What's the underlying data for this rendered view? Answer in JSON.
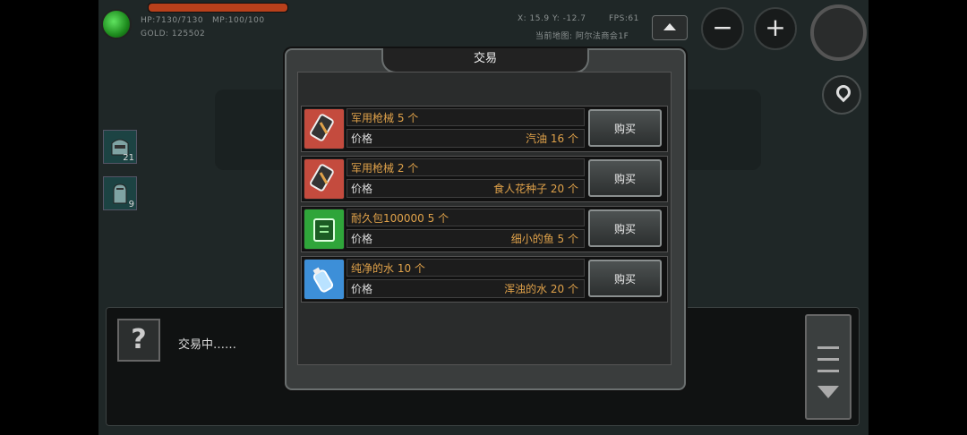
{
  "hud": {
    "hp": "HP:7130/7130",
    "mp": "MP:100/100",
    "gold": "GOLD: 125502",
    "coords": "X: 15.9 Y: -12.7",
    "fps": "FPS:61",
    "location": "当前地图: 阿尔法商会1F",
    "hp_fraction": 1.0,
    "zoom_out": "−",
    "zoom_in": "+"
  },
  "quickslots": [
    {
      "icon": "helmet-icon",
      "count": "21"
    },
    {
      "icon": "gauntlet-icon",
      "count": "9"
    }
  ],
  "dialog": {
    "text": "交易中……",
    "portrait": "?"
  },
  "trade": {
    "title": "交易",
    "price_label": "价格",
    "buy_label": "购买",
    "items": [
      {
        "name": "军用枪械 5 个",
        "price": "汽油 16 个",
        "icon": "gun-parts-icon",
        "color": "#c44b3e"
      },
      {
        "name": "军用枪械 2 个",
        "price": "食人花种子 20 个",
        "icon": "gun-parts-icon",
        "color": "#c44b3e"
      },
      {
        "name": "耐久包100000 5 个",
        "price": "细小的鱼 5 个",
        "icon": "durability-pack-icon",
        "color": "#2fa53a"
      },
      {
        "name": "纯净的水 10 个",
        "price": "浑浊的水 20 个",
        "icon": "water-bottle-icon",
        "color": "#3d8fd8"
      }
    ]
  }
}
